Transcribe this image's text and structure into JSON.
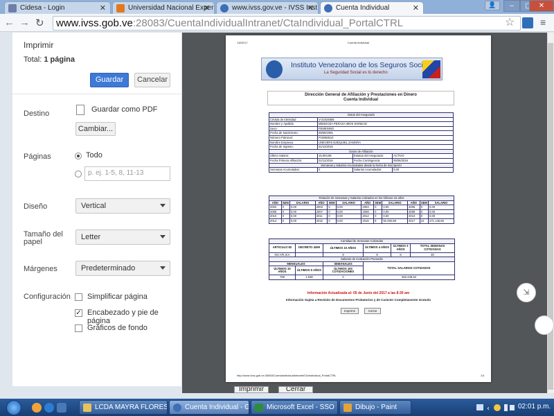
{
  "browser": {
    "tabs": [
      {
        "title": "Cidesa - Login",
        "color": "#6d7fa8"
      },
      {
        "title": "Universidad Nacional Experin",
        "color": "#e07a1f"
      },
      {
        "title": "www.ivss.gov.ve - IVSS Inst",
        "color": "#3d6fb6"
      },
      {
        "title": "Cuenta Individual",
        "color": "#3d6fb6"
      }
    ],
    "url_host": "www.ivss.gob.ve",
    "url_rest": ":28083/CuentaIndividualIntranet/CtaIndividual_PortalCTRL"
  },
  "print": {
    "title": "Imprimir",
    "total_label": "Total:",
    "total_value": "1 página",
    "save": "Guardar",
    "cancel": "Cancelar",
    "destination_label": "Destino",
    "destination_value": "Guardar como PDF",
    "change": "Cambiar...",
    "pages_label": "Páginas",
    "pages_all": "Todo",
    "pages_placeholder": "p. ej. 1-5, 8, 11-13",
    "layout_label": "Diseño",
    "layout_value": "Vertical",
    "paper_label": "Tamaño del papel",
    "paper_value": "Letter",
    "margins_label": "Márgenes",
    "margins_value": "Predeterminado",
    "config_label": "Configuración",
    "opt_simplify": "Simplificar página",
    "opt_headers": "Encabezado y pie de página",
    "opt_bg": "Gráficos de fondo",
    "bottom_print": "Imprimir",
    "bottom_cancel": "Cerrar"
  },
  "page": {
    "date": "13/02/17",
    "header_title": "Cuenta Individual",
    "org_name": "Instituto Venezolano de los Seguros Sociales",
    "org_tagline": "La Seguridad Social es tú derecho",
    "heading_line1": "Dirección General de Afiliación y Prestaciones en Dinero",
    "heading_line2": "Cuenta Individual",
    "insured": {
      "section": "Datos del Asegurado",
      "rows": [
        [
          "Cédula de Identidad",
          "V-21024655"
        ],
        [
          "Nombre y Apellido",
          "MENDOZA PERAZA IMOS SHINEAD"
        ],
        [
          "Sexo:",
          "FEMENINO"
        ],
        [
          "Fecha de Nacimiento:",
          "05/06/1991"
        ],
        [
          "Número Patronal:",
          "P19853510"
        ],
        [
          "Nombre Empresa:",
          "UNEVERS EZEQUIEL ZAMORA"
        ],
        [
          "Fecha de Ingreso:",
          "01/11/2016"
        ]
      ],
      "affil_section": "Datos de Afiliación",
      "affil_rows": [
        [
          "Último Salario:",
          "15.004,96",
          "Estatus del Asegurado:",
          "ACTIVO"
        ],
        [
          "Fecha Primera Afiliación:",
          "01/11/2016",
          "Fecha Contingencia:",
          "05/06/2016"
        ]
      ],
      "weeks_section": "Semanas y Salarios Acumulados desde la fecha de Inscripción",
      "weeks_row": [
        "Semanas Acumuladas:",
        "0",
        "Salarios Acumulados:",
        "0,00"
      ]
    },
    "history": {
      "section": "Relación de Semanas y Salarios cotizados en los Últimos 15 años",
      "headers": [
        "AÑO",
        "SEM",
        "SALARIO"
      ],
      "rows": [
        [
          [
            "2002",
            "0",
            "0,00"
          ],
          [
            "2003",
            "0",
            "0,00"
          ],
          [
            "2004",
            "0",
            "0,00"
          ],
          [
            "2005",
            "0",
            "0,00"
          ]
        ],
        [
          [
            "2006",
            "0",
            "0,00"
          ],
          [
            "2007",
            "0",
            "0,00"
          ],
          [
            "2008",
            "0",
            "0,00"
          ],
          [
            "2009",
            "0",
            "0,00"
          ]
        ],
        [
          [
            "2010",
            "0",
            "0,00"
          ],
          [
            "2011",
            "0",
            "0,00"
          ],
          [
            "2012",
            "0",
            "0,00"
          ],
          [
            "2013",
            "0",
            "0,00"
          ]
        ],
        [
          [
            "2014",
            "0",
            "0,00"
          ],
          [
            "2015",
            "0",
            "0,00"
          ],
          [
            "2016",
            "8",
            "92.292,88"
          ],
          [
            "2017",
            "22",
            "271.146,65"
          ]
        ]
      ]
    },
    "contrib": {
      "section": "Cantidad de Semanas Cotizadas",
      "headers": [
        "ARTICULO 82",
        "DECRETO 4269",
        "ÚLTIMOS 10 AÑOS",
        "ÚLTIMOS 4 AÑOS",
        "ÚLTIMOS 3 AÑOS",
        "TOTAL SEMANAS COTIZADAS"
      ],
      "values": [
        "NO APLICA",
        "",
        "8",
        "8",
        "8",
        "30"
      ],
      "avg_section": "Salarios de Cotización Promedio",
      "avg_group1": "MENSUALES",
      "avg_group2": "SEMANALES",
      "avg_headers": [
        "ÚLTIMOS 10 AÑOS",
        "ÚLTIMOS 5 AÑOS",
        "ÚLTIMOS 100 COTIZACIONES"
      ],
      "avg_total_header": "TOTAL SALARIOS COTIZADOS",
      "avg_values": [
        "769",
        "1.538",
        "0"
      ],
      "avg_total": "363.439,53"
    },
    "updated": "Información Actualizada al: 05 de Junio del 2017 a las 8:30 am",
    "disclaimer": "Información Sujeta a Revisión de Documentos Probatorios y de Carácter Completamente Gratuito",
    "btn_print": "Imprimir",
    "btn_close": "Cerrar",
    "footer_url": "http://www.ivss.gob.ve:28083/CuentaIndividualIntranet/CtaIndividual_PortalCTRL",
    "footer_page": "1/1"
  },
  "taskbar": {
    "tasks": [
      {
        "label": "LCDA MAYRA FLORES",
        "color": "#e8c25a"
      },
      {
        "label": "Cuenta Individual - Go...",
        "color": "#3d6fb6"
      },
      {
        "label": "Microsoft Excel - SSO",
        "color": "#2e8b3f"
      },
      {
        "label": "Dibujo - Paint",
        "color": "#e3a33b"
      }
    ],
    "clock": "02:01 p.m."
  }
}
